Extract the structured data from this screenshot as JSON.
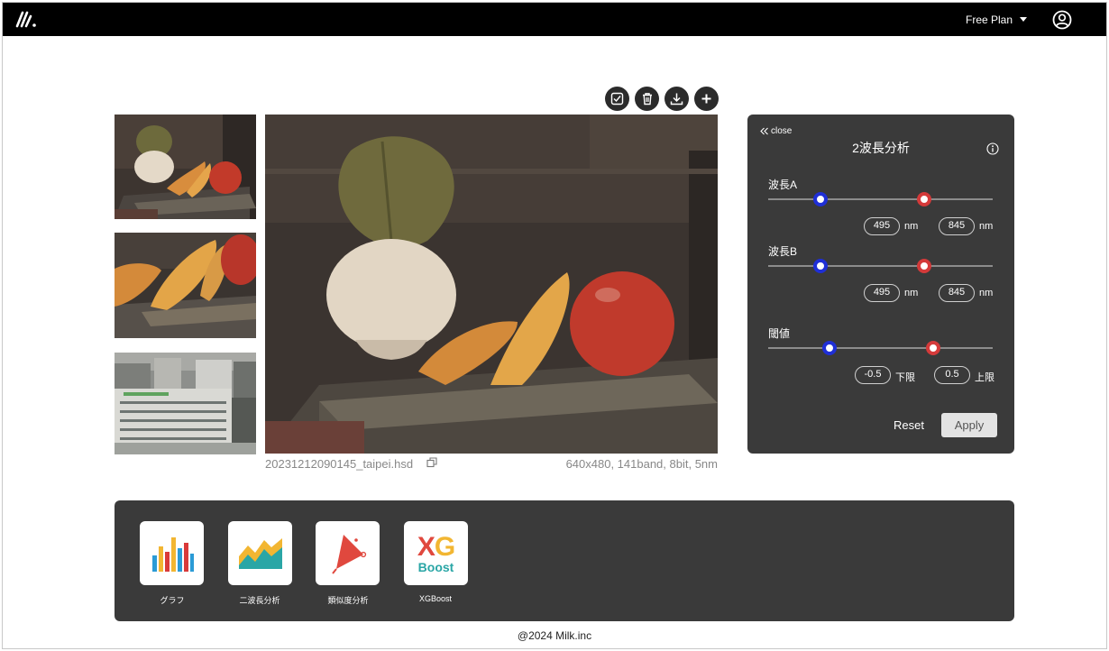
{
  "header": {
    "logo_icon": "milk-logo-icon",
    "plan_label": "Free Plan",
    "account_icon": "user-circle-icon"
  },
  "image_toolbar": [
    {
      "name": "select-button",
      "icon": "checkbox-icon"
    },
    {
      "name": "delete-button",
      "icon": "trash-icon"
    },
    {
      "name": "download-button",
      "icon": "download-icon"
    },
    {
      "name": "add-button",
      "icon": "plus-icon"
    }
  ],
  "image": {
    "filename": "20231212090145_taipei.hsd",
    "meta": "640x480, 141band, 8bit, 5nm"
  },
  "panel": {
    "close_label": "close",
    "title": "2波長分析",
    "wavelength_a": {
      "label": "波長A",
      "min": "495",
      "max": "845",
      "unit": "nm"
    },
    "wavelength_b": {
      "label": "波長B",
      "min": "495",
      "max": "845",
      "unit": "nm"
    },
    "threshold": {
      "label": "閾値",
      "lower": "-0.5",
      "lower_label": "下限",
      "upper": "0.5",
      "upper_label": "上限"
    },
    "reset_label": "Reset",
    "apply_label": "Apply"
  },
  "tools": [
    {
      "label": "グラフ",
      "icon": "bar-chart-icon"
    },
    {
      "label": "二波長分析",
      "icon": "area-chart-icon"
    },
    {
      "label": "類似度分析",
      "icon": "cone-similarity-icon"
    },
    {
      "label": "XGBoost",
      "icon": "xgboost-icon",
      "logo_top": "XG",
      "logo_bottom": "Boost"
    }
  ],
  "footer": {
    "copyright": "@2024 Milk.inc"
  },
  "colors": {
    "topbar": "#000000",
    "panel": "#3a3a3a",
    "knob_min": "#1f2fd6",
    "knob_max": "#d43a3a"
  }
}
